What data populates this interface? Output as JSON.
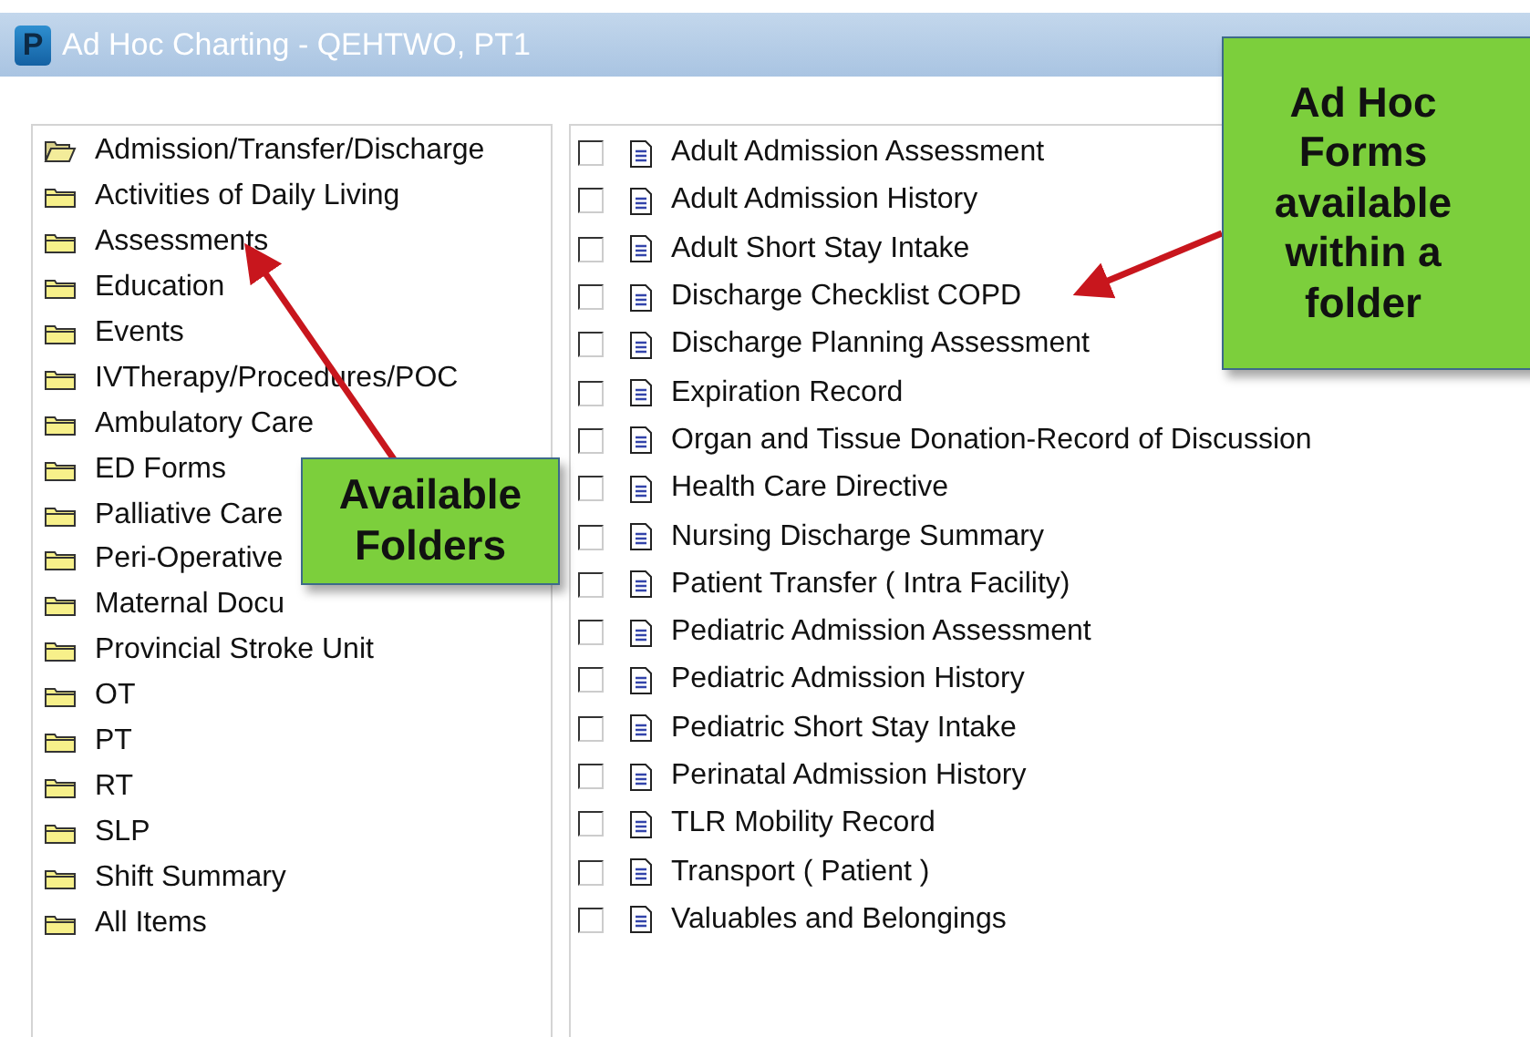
{
  "window": {
    "title": "Ad Hoc Charting - QEHTWO, PT1",
    "app_icon_letter": "P"
  },
  "folders": [
    {
      "label": "Admission/Transfer/Discharge",
      "expanded": true
    },
    {
      "label": "Activities of Daily Living",
      "expanded": false
    },
    {
      "label": "Assessments",
      "expanded": false
    },
    {
      "label": "Education",
      "expanded": false
    },
    {
      "label": "Events",
      "expanded": false
    },
    {
      "label": "IVTherapy/Procedures/POC",
      "expanded": false
    },
    {
      "label": "Ambulatory Care",
      "expanded": false
    },
    {
      "label": "ED Forms",
      "expanded": false
    },
    {
      "label": "Palliative Care",
      "expanded": false
    },
    {
      "label": "Peri-Operative",
      "expanded": false
    },
    {
      "label": "Maternal Docu",
      "expanded": false
    },
    {
      "label": "Provincial Stroke Unit",
      "expanded": false
    },
    {
      "label": "OT",
      "expanded": false
    },
    {
      "label": "PT",
      "expanded": false
    },
    {
      "label": "RT",
      "expanded": false
    },
    {
      "label": "SLP",
      "expanded": false
    },
    {
      "label": "Shift Summary",
      "expanded": false
    },
    {
      "label": "All Items",
      "expanded": false
    }
  ],
  "forms": [
    {
      "label": "Adult Admission Assessment",
      "checked": false
    },
    {
      "label": "Adult Admission History",
      "checked": false
    },
    {
      "label": "Adult Short Stay Intake",
      "checked": false
    },
    {
      "label": "Discharge Checklist COPD",
      "checked": false
    },
    {
      "label": "Discharge Planning Assessment",
      "checked": false
    },
    {
      "label": "Expiration Record",
      "checked": false
    },
    {
      "label": "Organ and Tissue Donation-Record of Discussion",
      "checked": false
    },
    {
      "label": "Health Care Directive",
      "checked": false
    },
    {
      "label": "Nursing Discharge Summary",
      "checked": false
    },
    {
      "label": "Patient Transfer ( Intra Facility)",
      "checked": false
    },
    {
      "label": "Pediatric Admission Assessment",
      "checked": false
    },
    {
      "label": "Pediatric Admission History",
      "checked": false
    },
    {
      "label": "Pediatric Short Stay Intake",
      "checked": false
    },
    {
      "label": "Perinatal Admission History",
      "checked": false
    },
    {
      "label": "TLR Mobility Record",
      "checked": false
    },
    {
      "label": "Transport ( Patient )",
      "checked": false
    },
    {
      "label": "Valuables and Belongings",
      "checked": false
    }
  ],
  "callouts": [
    {
      "text": "Available Folders"
    },
    {
      "text": "Ad Hoc Forms available within a folder"
    }
  ]
}
